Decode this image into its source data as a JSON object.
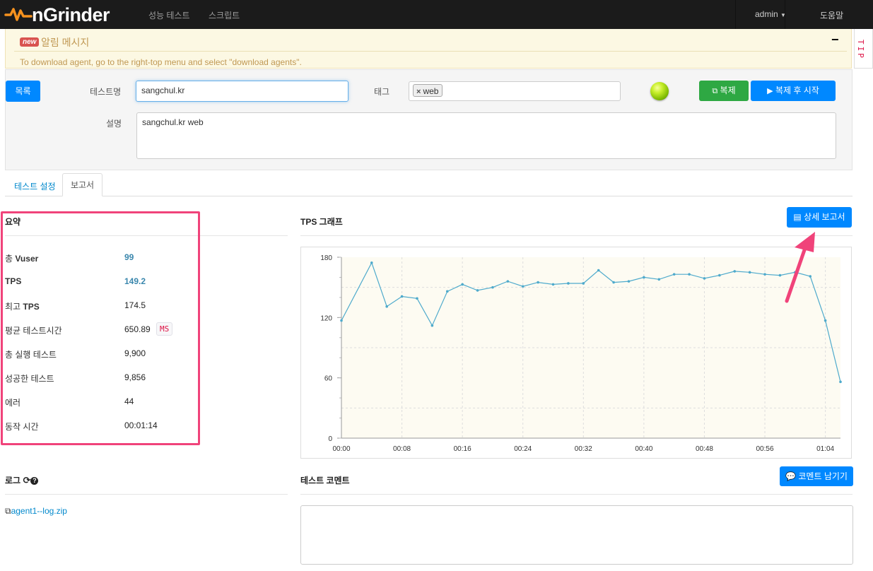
{
  "app": {
    "logo": "nGrinder"
  },
  "nav": {
    "perf_test": "성능 테스트",
    "script": "스크립트",
    "admin": "admin",
    "help": "도움말"
  },
  "notice": {
    "badge": "new",
    "title": "알림 메시지",
    "collapse": "−",
    "message": "To download agent, go to the right-top menu and select \"download agents\".",
    "tip": "TIP"
  },
  "form": {
    "list_button": "목록",
    "test_name_label": "테스트명",
    "test_name_value": "sangchul.kr",
    "tag_label": "태그",
    "tag_value": "web",
    "copy_button": "복제",
    "copy_start_button": "복제 후 시작",
    "desc_label": "설명",
    "desc_value": "sangchul.kr web",
    "status_color": "#9ad400"
  },
  "tabs": {
    "settings": "테스트 설정",
    "report": "보고서"
  },
  "summary": {
    "title": "요약",
    "rows": [
      {
        "label_pre": "총 ",
        "label_bold": "Vuser",
        "value": "99"
      },
      {
        "label_pre": "",
        "label_bold": "TPS",
        "value": "149.2"
      },
      {
        "label_pre": "최고 ",
        "label_bold": "TPS",
        "value": "174.5"
      },
      {
        "label_pre": "평균 테스트시간",
        "label_bold": "",
        "value": "650.89",
        "unit": "MS"
      },
      {
        "label_pre": "총 실행 테스트",
        "label_bold": "",
        "value": "9,900"
      },
      {
        "label_pre": "성공한 테스트",
        "label_bold": "",
        "value": "9,856"
      },
      {
        "label_pre": "에러",
        "label_bold": "",
        "value": "44"
      },
      {
        "label_pre": "동작 시간",
        "label_bold": "",
        "value": "00:01:14"
      }
    ]
  },
  "tps": {
    "title": "TPS 그래프",
    "detail_button": "상세 보고서"
  },
  "log": {
    "title": "로그",
    "file": "agent1--log.zip"
  },
  "comment": {
    "title": "테스트 코멘트",
    "button": "코멘트 남기기"
  },
  "chart_data": {
    "type": "line",
    "title": "",
    "xlabel": "",
    "ylabel": "",
    "ylim": [
      0,
      180
    ],
    "xlim": [
      0,
      66
    ],
    "x_ticks": [
      "00:00",
      "00:08",
      "00:16",
      "00:24",
      "00:32",
      "00:40",
      "00:48",
      "00:56",
      "01:04"
    ],
    "y_ticks": [
      0,
      60,
      120,
      180
    ],
    "grid": true,
    "x": [
      0,
      4,
      6,
      8,
      10,
      12,
      14,
      16,
      18,
      20,
      22,
      24,
      26,
      28,
      30,
      32,
      34,
      36,
      38,
      40,
      42,
      44,
      46,
      48,
      50,
      52,
      54,
      56,
      58,
      60,
      62,
      64,
      66
    ],
    "values": [
      117,
      174.5,
      131,
      141,
      139,
      112,
      146,
      153,
      147,
      150,
      156,
      151,
      155,
      153,
      154,
      154,
      167,
      155,
      156,
      160,
      158,
      163,
      163,
      159,
      162,
      166,
      165,
      163,
      162,
      165,
      161,
      117,
      56
    ],
    "line_color": "#4eaacc",
    "background": "#fdfbf2"
  },
  "annotation": {
    "color": "#f0437a"
  }
}
